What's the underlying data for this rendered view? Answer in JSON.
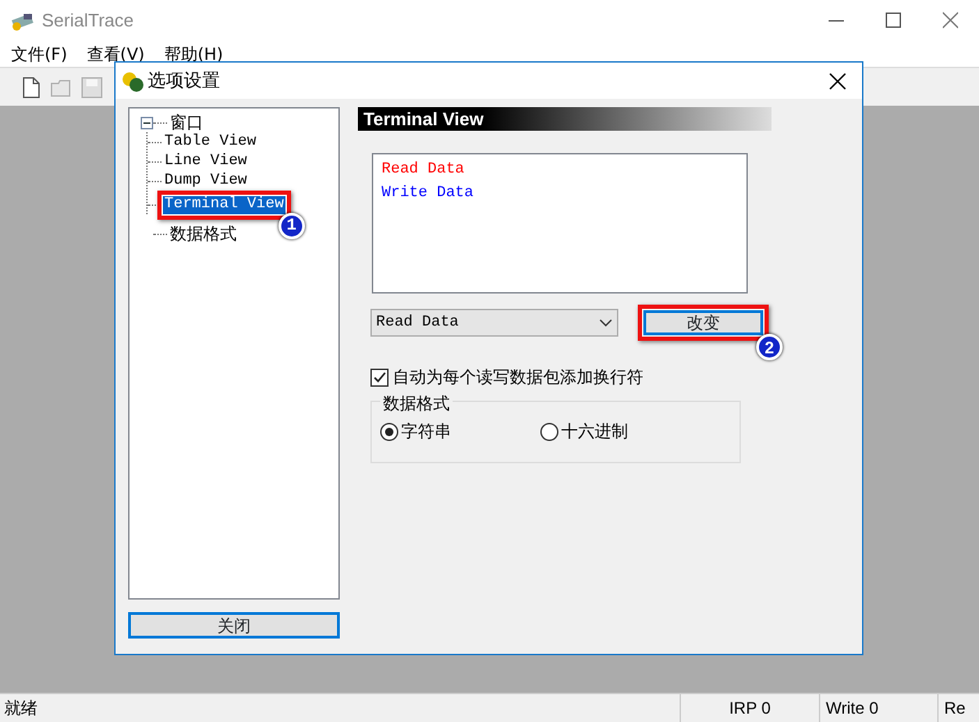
{
  "window": {
    "title": "SerialTrace"
  },
  "menu": [
    {
      "label": "文件(F)"
    },
    {
      "label": "查看(V)"
    },
    {
      "label": "帮助(H)"
    }
  ],
  "toolbar": [
    {
      "kind": "new",
      "disabled": false
    },
    {
      "kind": "open",
      "disabled": true
    },
    {
      "kind": "save",
      "disabled": true
    }
  ],
  "dialog": {
    "title": "选项设置",
    "tree": [
      {
        "label": "窗口",
        "expanded": true,
        "selected": false,
        "children": [
          {
            "label": "Table View",
            "selected": false
          },
          {
            "label": "Line View",
            "selected": false
          },
          {
            "label": "Dump View",
            "selected": false
          },
          {
            "label": "Terminal View",
            "selected": true,
            "callout": "1"
          }
        ]
      },
      {
        "label": "数据格式",
        "selected": false
      }
    ],
    "close_button": "关闭",
    "section_title": "Terminal View",
    "list": [
      {
        "text": "Read Data",
        "color": "#ff0000"
      },
      {
        "text": "Write Data",
        "color": "#0000ff"
      }
    ],
    "dropdown": {
      "value": "Read Data"
    },
    "change_button": {
      "label": "改变",
      "callout": "2"
    },
    "auto_newline": {
      "label": "自动为每个读写数据包添加换行符",
      "checked": true
    },
    "format_group": {
      "title": "数据格式",
      "options": [
        {
          "label": "字符串",
          "selected": true
        },
        {
          "label": "十六进制",
          "selected": false
        }
      ]
    }
  },
  "status_bar": [
    "就绪",
    "IRP 0",
    "Write 0",
    "Re"
  ]
}
